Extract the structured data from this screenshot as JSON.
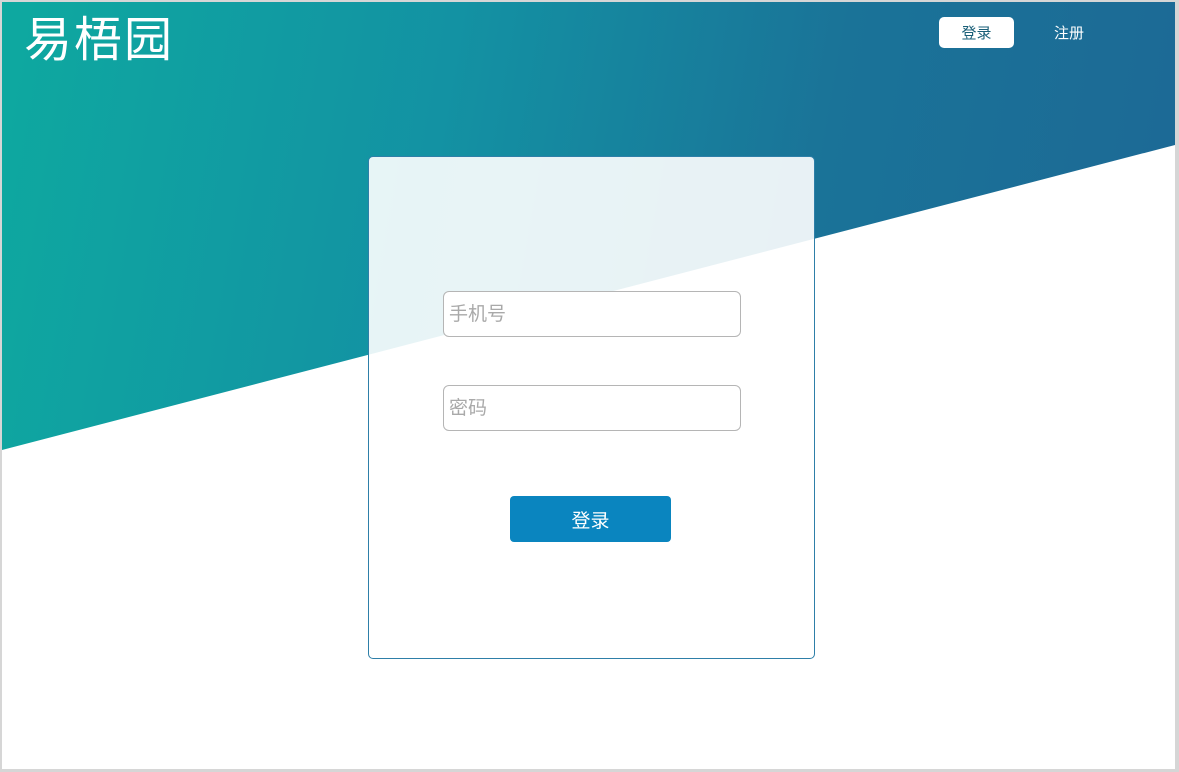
{
  "header": {
    "logo": "易梧园",
    "nav": {
      "login_label": "登录",
      "register_label": "注册"
    }
  },
  "login_form": {
    "phone": {
      "placeholder": "手机号",
      "value": ""
    },
    "password": {
      "placeholder": "密码",
      "value": ""
    },
    "submit_label": "登录"
  },
  "colors": {
    "gradient_start": "#0ea9a0",
    "gradient_end": "#1d6795",
    "button": "#0a85bf",
    "card_border": "#2e7fa8"
  }
}
